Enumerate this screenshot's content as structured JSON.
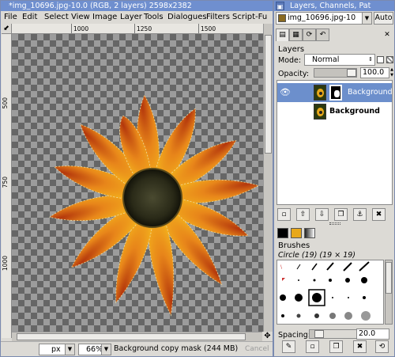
{
  "image_window": {
    "title": "*img_10696.jpg-10.0 (RGB, 2 layers) 2598x2382",
    "menus": [
      "File",
      "Edit",
      "Select",
      "View",
      "Image",
      "Layer",
      "Tools",
      "Dialogues",
      "Filters",
      "Script-Fu"
    ],
    "ruler_corner": "⬋",
    "top_ruler_ticks": [
      "1000",
      "1250",
      "1500"
    ],
    "left_ruler_ticks": [
      "500",
      "750",
      "1000"
    ],
    "units": "px",
    "zoom": "66%",
    "status_text": "Background copy mask (244 MB)",
    "cancel_label": "Cancel",
    "nav_icon": "✥"
  },
  "dock": {
    "title": "Layers, Channels, Pat",
    "image_select": "img_10696.jpg-10",
    "auto_label": "Auto",
    "tab_icons": [
      "layers-icon",
      "channels-icon",
      "paths-icon",
      "undo-icon"
    ],
    "tab_glyphs": [
      "▤",
      "▦",
      "⟳",
      "↶"
    ],
    "tab_close": "✕",
    "layers": {
      "title": "Layers",
      "mode_label": "Mode:",
      "mode_value": "Normal",
      "opacity_label": "Opacity:",
      "opacity_value": "100.0",
      "opacity": 1.0,
      "items": [
        {
          "name": "Background c",
          "selected": true,
          "has_mask": true,
          "visible": true
        },
        {
          "name": "Background",
          "selected": false,
          "has_mask": false,
          "visible": false
        }
      ],
      "buttons": [
        "new-layer",
        "raise-layer",
        "lower-layer",
        "duplicate-layer",
        "anchor-layer",
        "delete-layer"
      ],
      "button_glyphs": [
        "▫",
        "⇧",
        "⇩",
        "❐",
        "⚓",
        "✖"
      ]
    },
    "brushes": {
      "fg_color": "#000000",
      "bg_color": "#e8a81a",
      "title": "Brushes",
      "current": "Circle (19) (19 × 19)",
      "spacing_label": "Spacing:",
      "spacing_value": "20.0",
      "spacing": 20,
      "buttons": [
        "edit-brush",
        "new-brush",
        "duplicate-brush",
        "delete-brush",
        "refresh-brushes"
      ],
      "button_glyphs": [
        "✎",
        "▫",
        "❐",
        "✖",
        "⟲"
      ]
    }
  },
  "colors": {
    "titlebar": "#6f8fcf",
    "selection": "#6c8fcc",
    "window_bg": "#dcdad5"
  }
}
